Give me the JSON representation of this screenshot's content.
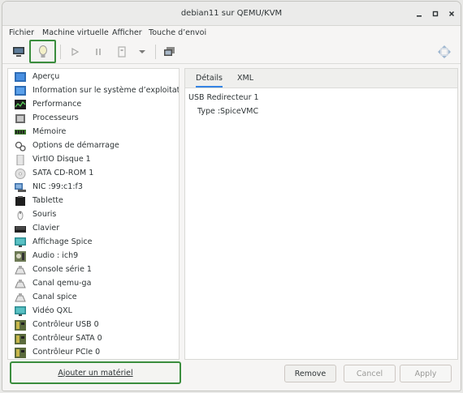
{
  "window": {
    "title": "debian11 sur QEMU/KVM"
  },
  "menu": [
    "Fichier",
    "Machine virtuelle",
    "Afficher",
    "Touche d’envoi"
  ],
  "toolbar": [
    "console-icon",
    "lightbulb-icon",
    "play-icon",
    "pause-icon",
    "power-icon",
    "dropdown-icon",
    "snapshot-icon",
    "fullscreen-icon"
  ],
  "hardware": [
    {
      "label": "Aperçu",
      "icon": "overview-icon"
    },
    {
      "label": "Information sur le système d’exploitation",
      "icon": "os-info-icon"
    },
    {
      "label": "Performance",
      "icon": "performance-icon"
    },
    {
      "label": "Processeurs",
      "icon": "cpu-icon"
    },
    {
      "label": "Mémoire",
      "icon": "memory-icon"
    },
    {
      "label": "Options de démarrage",
      "icon": "boot-icon"
    },
    {
      "label": "VirtIO Disque 1",
      "icon": "disk-icon"
    },
    {
      "label": "SATA CD-ROM 1",
      "icon": "cdrom-icon"
    },
    {
      "label": "NIC :99:c1:f3",
      "icon": "nic-icon"
    },
    {
      "label": "Tablette",
      "icon": "tablet-icon"
    },
    {
      "label": "Souris",
      "icon": "mouse-icon"
    },
    {
      "label": "Clavier",
      "icon": "keyboard-icon"
    },
    {
      "label": "Affichage Spice",
      "icon": "display-icon"
    },
    {
      "label": "Audio : ich9",
      "icon": "audio-icon"
    },
    {
      "label": "Console série 1",
      "icon": "serial-icon"
    },
    {
      "label": "Canal qemu-ga",
      "icon": "channel-icon"
    },
    {
      "label": "Canal spice",
      "icon": "channel-icon"
    },
    {
      "label": "Vidéo QXL",
      "icon": "video-icon"
    },
    {
      "label": "Contrôleur USB 0",
      "icon": "controller-icon"
    },
    {
      "label": "Contrôleur SATA 0",
      "icon": "controller-icon"
    },
    {
      "label": "Contrôleur PCIe 0",
      "icon": "controller-icon"
    }
  ],
  "add_button": "Ajouter un matériel",
  "tabs": [
    "Détails",
    "XML"
  ],
  "details": {
    "title": "USB Redirecteur 1",
    "type_label": "Type :",
    "type_value": "SpiceVMC"
  },
  "buttons": {
    "remove": "Remove",
    "cancel": "Cancel",
    "apply": "Apply"
  }
}
